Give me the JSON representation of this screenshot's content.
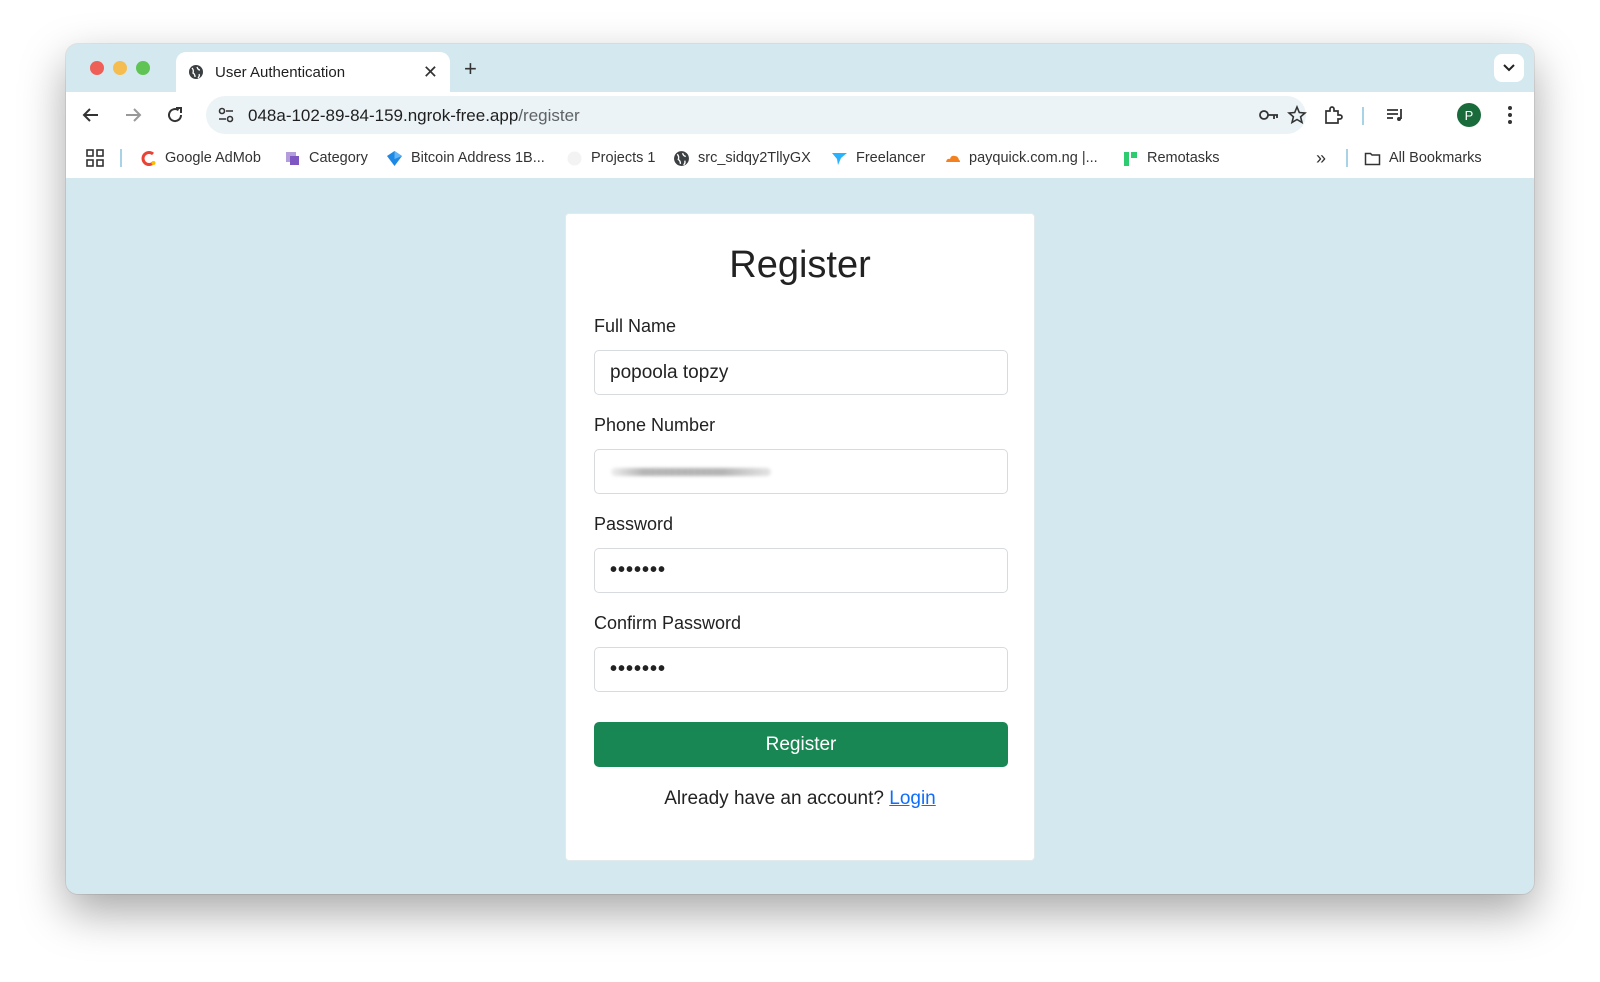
{
  "browser": {
    "tab_title": "User Authentication",
    "new_tab_symbol": "+",
    "close_symbol": "✕",
    "url_host": "048a-102-89-84-159.ngrok-free.app",
    "url_path": "/register",
    "profile_initial": "P"
  },
  "bookmarks": {
    "items": [
      {
        "label": "Google AdMob",
        "icon": "admob-icon"
      },
      {
        "label": "Category",
        "icon": "category-icon"
      },
      {
        "label": "Bitcoin Address 1B...",
        "icon": "bitcoin-icon"
      },
      {
        "label": "Projects 1",
        "icon": "blank-page-icon"
      },
      {
        "label": "src_sidqy2TllyGX",
        "icon": "globe-icon"
      },
      {
        "label": "Freelancer",
        "icon": "freelancer-icon"
      },
      {
        "label": "payquick.com.ng |...",
        "icon": "cloudflare-icon"
      },
      {
        "label": "Remotasks",
        "icon": "remotasks-icon"
      }
    ],
    "overflow": "»",
    "all_bookmarks": "All Bookmarks"
  },
  "form": {
    "title": "Register",
    "full_name_label": "Full Name",
    "full_name_value": "popoola topzy",
    "phone_label": "Phone Number",
    "password_label": "Password",
    "password_value": "•••••••",
    "confirm_label": "Confirm Password",
    "confirm_value": "•••••••",
    "submit_label": "Register",
    "already_text": "Already have an account?",
    "login_link": "Login"
  },
  "colors": {
    "page_bg": "#d3e8ef",
    "button": "#198754",
    "link": "#0d6efd",
    "avatar": "#1a6b3b"
  }
}
